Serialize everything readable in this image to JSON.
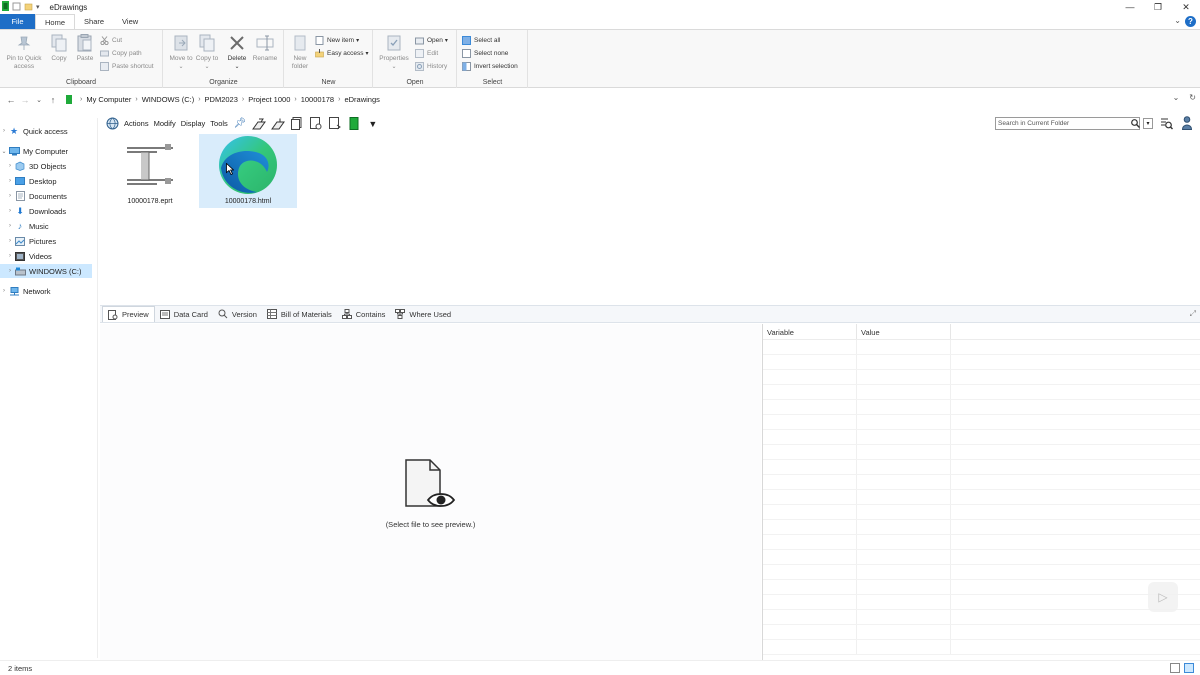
{
  "window": {
    "title": "eDrawings"
  },
  "ribbon_tabs": [
    "File",
    "Home",
    "Share",
    "View"
  ],
  "ribbon": {
    "clipboard": {
      "label": "Clipboard",
      "pin": "Pin to Quick access",
      "copy": "Copy",
      "paste": "Paste",
      "cut": "Cut",
      "copy_path": "Copy path",
      "paste_shortcut": "Paste shortcut"
    },
    "organize": {
      "label": "Organize",
      "move_to": "Move to",
      "copy_to": "Copy to",
      "delete": "Delete",
      "rename": "Rename"
    },
    "new": {
      "label": "New",
      "new_folder": "New folder",
      "new_item": "New item",
      "easy_access": "Easy access"
    },
    "open": {
      "label": "Open",
      "properties": "Properties",
      "open": "Open",
      "edit": "Edit",
      "history": "History"
    },
    "select": {
      "label": "Select",
      "select_all": "Select all",
      "select_none": "Select none",
      "invert": "Invert selection"
    }
  },
  "breadcrumbs": [
    "My Computer",
    "WINDOWS (C:)",
    "PDM2023",
    "Project 1000",
    "10000178",
    "eDrawings"
  ],
  "nav": {
    "quick_access": "Quick access",
    "my_computer": "My Computer",
    "items": [
      "3D Objects",
      "Desktop",
      "Documents",
      "Downloads",
      "Music",
      "Pictures",
      "Videos",
      "WINDOWS (C:)"
    ],
    "network": "Network"
  },
  "pdm_menu": [
    "Actions",
    "Modify",
    "Display",
    "Tools"
  ],
  "search": {
    "placeholder": "Search in Current Folder"
  },
  "files": [
    {
      "name": "10000178.eprt",
      "icon": "part-drawing-icon"
    },
    {
      "name": "10000178.html",
      "icon": "edge-browser-icon"
    }
  ],
  "preview_tabs": [
    "Preview",
    "Data Card",
    "Version",
    "Bill of Materials",
    "Contains",
    "Where Used"
  ],
  "preview": {
    "message": "(Select file to see preview.)"
  },
  "properties": {
    "col_variable": "Variable",
    "col_value": "Value"
  },
  "status": {
    "items": "2 items"
  },
  "colors": {
    "accent": "#1e6ec7",
    "selection": "#cce8ff",
    "pdm_green": "#1faa3a"
  }
}
